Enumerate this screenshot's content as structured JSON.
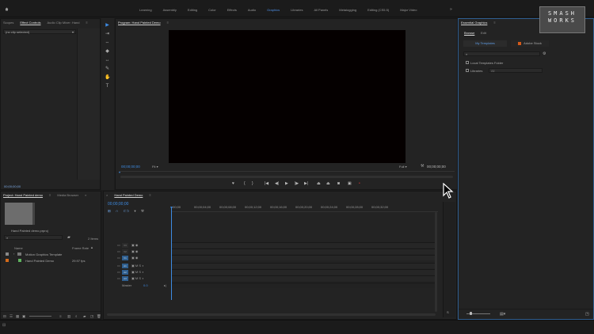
{
  "workspaces": {
    "items": [
      "Learning",
      "Assembly",
      "Editing",
      "Color",
      "Effects",
      "Audio",
      "Graphics",
      "Libraries",
      "All Panels",
      "Metalogging",
      "Editing (CS5.5)",
      "Major Video"
    ],
    "active": "Graphics"
  },
  "logo": {
    "lines": [
      "SMASH",
      "WORKS"
    ]
  },
  "source_panel": {
    "tabs": [
      "Scopes",
      "Effect Controls",
      "Audio Clip Mixer: Hand"
    ],
    "active_tab": "Effect Controls",
    "clip_dropdown": "(no clip selected)",
    "timecode": "00;00;00;00"
  },
  "program": {
    "title": "Program: Hand Painted Demo",
    "timecode_left": "00;00;00;00",
    "fit": "Fit",
    "quality": "Full",
    "timecode_right": "00;00;00;00"
  },
  "project": {
    "tabs": [
      "Project: Hand Painted demo",
      "Media Browser"
    ],
    "file": "Hand Painted demo.prproj",
    "item_count": "2 Items",
    "columns": [
      "Name",
      "Frame Rate"
    ],
    "rows": [
      {
        "name": "Motion Graphics Template",
        "rate": ""
      },
      {
        "name": "Hand Painted Demo",
        "rate": "29.97 fps"
      }
    ]
  },
  "timeline": {
    "title": "Hand Painted Demo",
    "timecode": "00;00;00;00",
    "ruler": [
      ":00;00",
      "00;00;04;00",
      "00;00;08;00",
      "00;00;12;00",
      "00;00;16;00",
      "00;00;20;00",
      "00;00;24;00",
      "00;00;28;00",
      "00;00;32;00"
    ],
    "video_tracks": [
      "V3",
      "V2",
      "V1"
    ],
    "audio_tracks": [
      "A1",
      "A2",
      "A3"
    ],
    "master": {
      "label": "Master",
      "value": "0.0"
    }
  },
  "essential_graphics": {
    "title": "Essential Graphics",
    "tabs": [
      "Browse",
      "Edit"
    ],
    "active_tab": "Browse",
    "sources": [
      "My Templates",
      "Adobe Stock"
    ],
    "options": [
      "Local Templates Folder",
      "Libraries"
    ],
    "libraries_value": "All"
  }
}
